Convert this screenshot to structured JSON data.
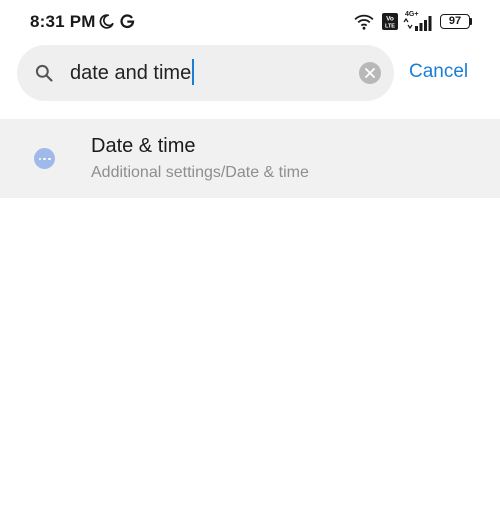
{
  "status_bar": {
    "time": "8:31 PM",
    "network_type": "4G+",
    "battery_level": "97",
    "icons": [
      "moon-icon",
      "google-icon",
      "wifi-icon",
      "volte-icon",
      "signal-icon",
      "battery-icon"
    ]
  },
  "search": {
    "query": "date and time",
    "cancel_label": "Cancel",
    "icons": [
      "search-icon",
      "clear-icon"
    ]
  },
  "results": [
    {
      "title": "Date & time",
      "subtitle": "Additional settings/Date & time",
      "icon": "more-icon"
    }
  ],
  "colors": {
    "accent": "#1a7fd4",
    "search_bg": "#efefef",
    "result_bg": "#f1f1f1",
    "result_icon": "#9fb9ea",
    "subtitle": "#8e8e8e"
  }
}
